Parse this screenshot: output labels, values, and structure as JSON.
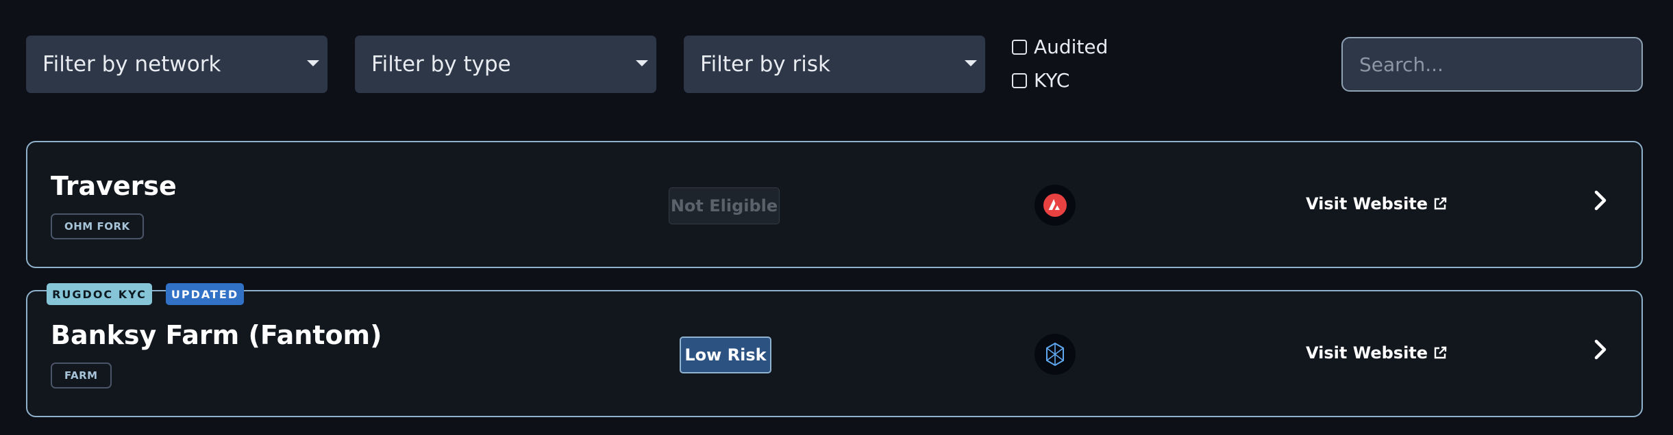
{
  "filters": {
    "network": {
      "label": "Filter by network"
    },
    "type": {
      "label": "Filter by type"
    },
    "risk": {
      "label": "Filter by risk"
    },
    "checkboxes": [
      {
        "label": "Audited",
        "checked": false
      },
      {
        "label": "KYC",
        "checked": false
      }
    ],
    "search": {
      "placeholder": "Search..."
    }
  },
  "projects": [
    {
      "name": "Traverse",
      "tag": "OHM FORK",
      "risk": "Not Eligible",
      "network_icon": "avalanche-icon",
      "visit_label": "Visit Website",
      "badges": []
    },
    {
      "name": "Banksy Farm (Fantom)",
      "tag": "FARM",
      "risk": "Low Risk",
      "network_icon": "fantom-icon",
      "visit_label": "Visit Website",
      "badges": [
        "RUGDOC KYC",
        "UPDATED"
      ]
    }
  ],
  "colors": {
    "background": "#0d1117",
    "card_border": "#8fb3cc",
    "low_risk": "#2c5282",
    "kyc_badge": "#86c5d8",
    "updated_badge": "#3171c6",
    "avalanche": "#e84142"
  }
}
